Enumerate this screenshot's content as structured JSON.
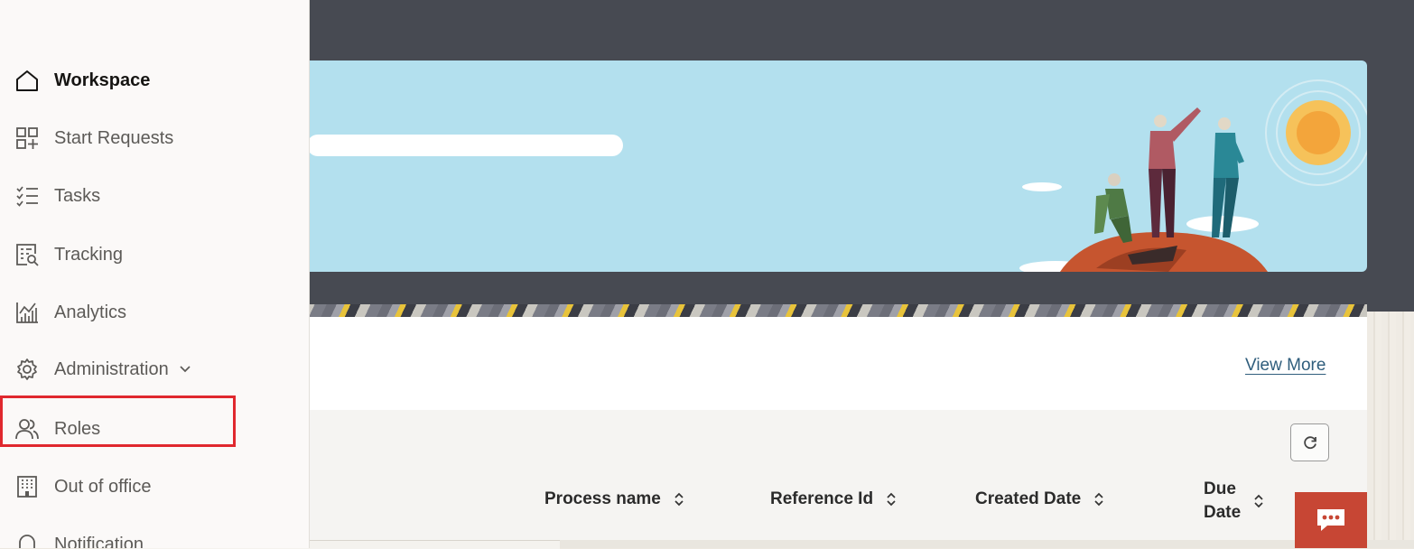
{
  "sidebar": {
    "items": [
      {
        "label": "Workspace",
        "icon": "home-icon",
        "active": true
      },
      {
        "label": "Start Requests",
        "icon": "apps-add-icon"
      },
      {
        "label": "Tasks",
        "icon": "checklist-icon"
      },
      {
        "label": "Tracking",
        "icon": "tracking-icon"
      },
      {
        "label": "Analytics",
        "icon": "analytics-icon"
      },
      {
        "label": "Administration",
        "icon": "gear-icon",
        "expandable": true
      },
      {
        "label": "Roles",
        "icon": "users-icon",
        "highlighted": true
      },
      {
        "label": "Out of office",
        "icon": "building-icon"
      },
      {
        "label": "Notification",
        "icon": "bell-icon"
      }
    ]
  },
  "main": {
    "view_more": "View More",
    "table": {
      "columns": [
        {
          "label": "Process name"
        },
        {
          "label": "Reference Id"
        },
        {
          "label": "Created Date"
        },
        {
          "label": "Due Date",
          "line1": "Due",
          "line2": "Date"
        }
      ]
    }
  },
  "colors": {
    "highlight_border": "#e0282e",
    "chat_button": "#c74634",
    "banner": "#b3e0ee",
    "header_dark": "#474a52"
  }
}
